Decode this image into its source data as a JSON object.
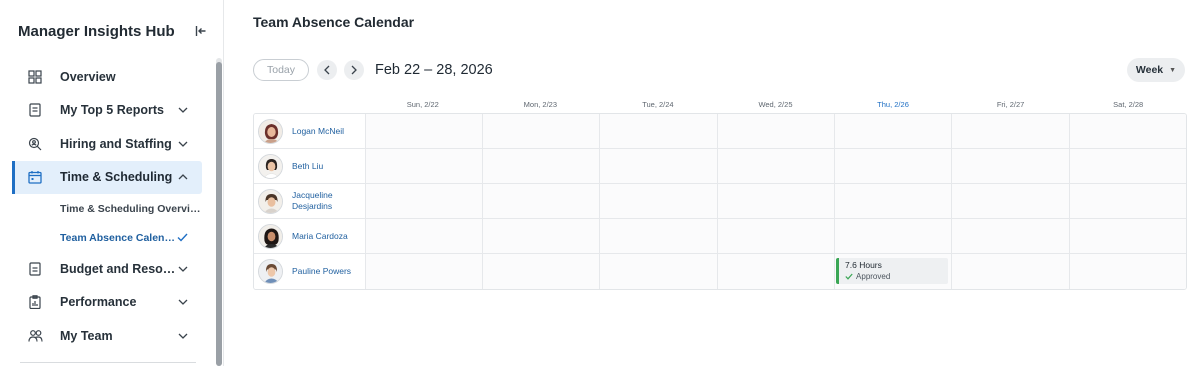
{
  "sidebar": {
    "title": "Manager Insights Hub",
    "items": [
      {
        "label": "Overview",
        "icon": "grid-icon"
      },
      {
        "label": "My Top 5 Reports",
        "icon": "report-icon"
      },
      {
        "label": "Hiring and Staffing",
        "icon": "search-person-icon"
      },
      {
        "label": "Time & Scheduling",
        "icon": "calendar-icon",
        "active": true
      },
      {
        "label": "Budget and Resources",
        "icon": "document-icon"
      },
      {
        "label": "Performance",
        "icon": "clipboard-chart-icon"
      },
      {
        "label": "My Team",
        "icon": "team-icon"
      }
    ],
    "subitems": [
      {
        "label": "Time & Scheduling Overview"
      },
      {
        "label": "Team Absence Calendar",
        "selected": true
      }
    ]
  },
  "main": {
    "title": "Team Absence Calendar",
    "today_label": "Today",
    "date_range": "Feb 22 – 28, 2026",
    "view_label": "Week",
    "days": [
      "Sun, 2/22",
      "Mon, 2/23",
      "Tue, 2/24",
      "Wed, 2/25",
      "Thu, 2/26",
      "Fri, 2/27",
      "Sat, 2/28"
    ],
    "today_index": 4,
    "people": [
      {
        "name": "Logan McNeil"
      },
      {
        "name": "Beth Liu"
      },
      {
        "name": "Jacqueline Desjardins"
      },
      {
        "name": "Maria Cardoza"
      },
      {
        "name": "Pauline Powers"
      }
    ],
    "absence": {
      "hours": "7.6 Hours",
      "status": "Approved",
      "accent": "#3aa655"
    }
  },
  "colors": {
    "accent": "#1f6fc4",
    "active_bg": "#e3effb"
  }
}
